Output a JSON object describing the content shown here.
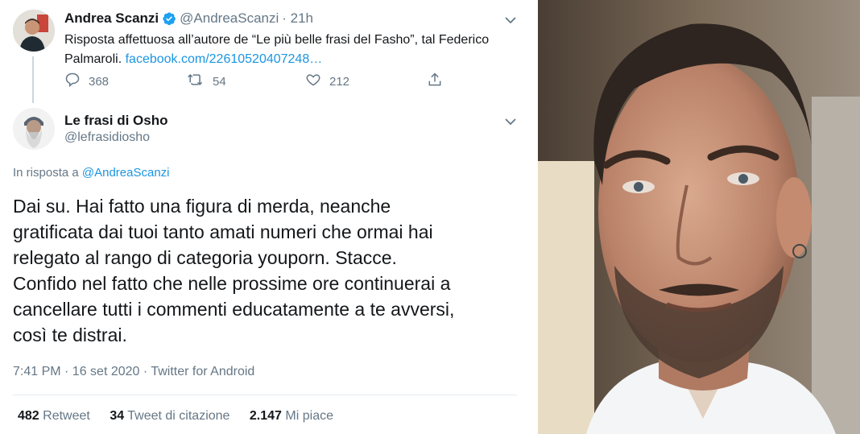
{
  "tweet1": {
    "author_name": "Andrea Scanzi",
    "author_handle": "@AndreaScanzi",
    "time": "· 21h",
    "text": "Risposta affettuosa all’autore de “Le più belle frasi del Fasho”, tal Federico Palmaroli.",
    "link": "facebook.com/22610520407248…",
    "replies": "368",
    "retweets": "54",
    "likes": "212",
    "icons": [
      "verified-badge-icon",
      "chevron-down-icon",
      "reply-icon",
      "retweet-icon",
      "like-icon",
      "share-icon"
    ]
  },
  "tweet2": {
    "author_name": "Le frasi di Osho",
    "author_handle": "@lefrasidiosho",
    "reply_prefix": "In risposta a",
    "reply_to": "@AndreaScanzi",
    "text_lines": [
      "Dai su. Hai fatto una figura di merda, neanche",
      "gratificata dai tuoi tanto amati numeri che ormai hai",
      "relegato al rango di categoria youporn. Stacce.",
      "Confido nel fatto che nelle prossime ore continuerai a",
      "cancellare tutti i commenti educatamente a te avversi,",
      "così te distrai."
    ],
    "meta": "7:41 PM · 16 set 2020 · Twitter for Android",
    "stats": {
      "retweet_count": "482",
      "retweet_label": "Retweet",
      "quote_count": "34",
      "quote_label": "Tweet di citazione",
      "like_count": "2.147",
      "like_label": "Mi piace"
    }
  },
  "colors": {
    "link": "#1b95e0",
    "secondary_text": "#657786",
    "primary_text": "#14171a",
    "verified": "#1da1f2"
  }
}
